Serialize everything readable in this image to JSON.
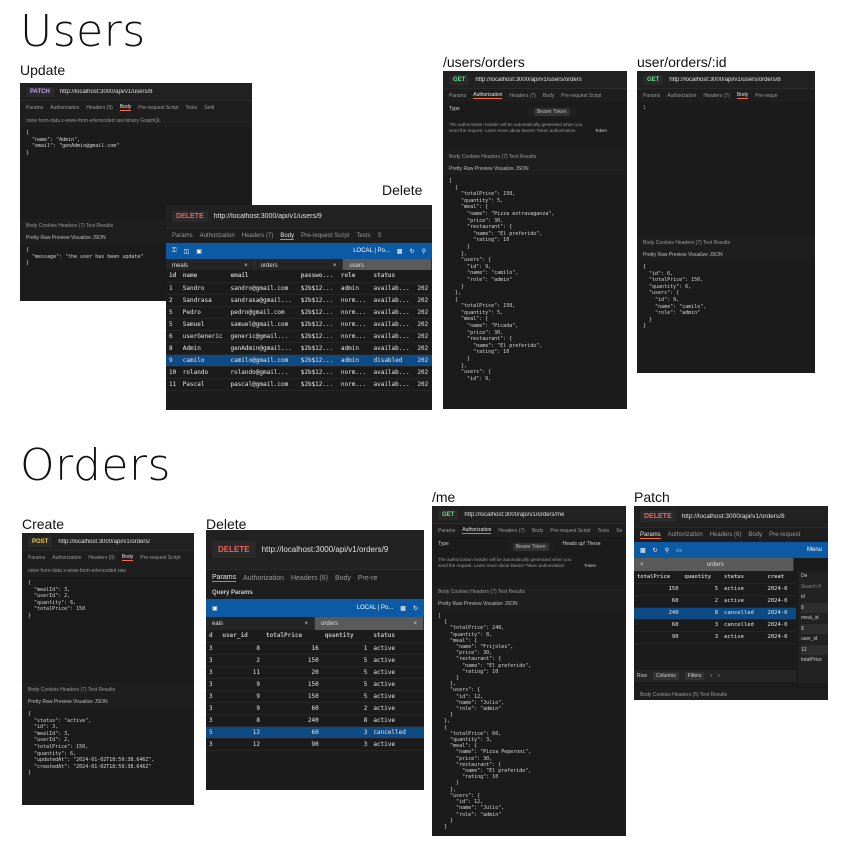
{
  "headings": {
    "users": "Users",
    "orders": "Orders"
  },
  "labels": {
    "update": "Update",
    "delete_user": "Delete",
    "users_orders": "/users/orders",
    "user_orders_id": "user/orders/:id",
    "create": "Create",
    "delete_order": "Delete",
    "me": "/me",
    "patch": "Patch"
  },
  "colors": {
    "get": "#6bdd9a",
    "post": "#f3ca4d",
    "patch": "#c6a0f6",
    "delete": "#f25f5c",
    "selection": "#0e4b84",
    "toolbar": "#0b5aa3"
  },
  "update": {
    "method": "PATCH",
    "url": "http://localhost:3000/api/v1/users/8",
    "tabs": [
      "Params",
      "Authorization",
      "Headers (9)",
      "Body",
      "Pre-request Script",
      "Tests",
      "Setti"
    ],
    "body_options": "none  form-data  x-www-form-urlencoded  raw  binary  GraphQL",
    "body_code": "{\n  \"name\": \"Admin\",\n  \"email\": \"genAdmin@gmail.com\"\n}",
    "resp_tabs": "Body  Cookies  Headers (7)  Test Results",
    "resp_views": "Pretty  Raw  Preview  Visualize  JSON",
    "resp_code": "{\n  \"message\": \"the user has been update\"\n}"
  },
  "delete_user": {
    "method": "DELETE",
    "url": "http://localhost:3000/api/v1/users/9",
    "tabs": [
      "Params",
      "Authorization",
      "Headers (7)",
      "Body",
      "Pre-request Script",
      "Tests",
      "S"
    ],
    "toolbar_db": "LOCAL | Po...",
    "tabstrip": [
      "meals",
      "orders",
      "users"
    ],
    "columns": [
      "id",
      "name",
      "email",
      "passwo...",
      "role",
      "status"
    ],
    "rows": [
      [
        "1",
        "Sandro",
        "sandro@gmail.com",
        "$2b$12...",
        "admin",
        "availab...",
        "202"
      ],
      [
        "2",
        "Sandrasa",
        "sandrasa@gmail...",
        "$2b$12...",
        "norm...",
        "availab...",
        "202"
      ],
      [
        "5",
        "Pedro",
        "pedro@gmail.com",
        "$2b$12...",
        "norm...",
        "availab...",
        "202"
      ],
      [
        "5",
        "Samuel",
        "samuel@gmail.com",
        "$2b$12...",
        "norm...",
        "availab...",
        "202"
      ],
      [
        "6",
        "userGeneric",
        "generic@gmail...",
        "$2b$12...",
        "norm...",
        "availab...",
        "202"
      ],
      [
        "8",
        "Admin",
        "genAdmin@gmail...",
        "$2b$12...",
        "admin",
        "availab...",
        "202"
      ],
      [
        "9",
        "camilo",
        "camilo@gmail.com",
        "$2b$12...",
        "admin",
        "disabled",
        "202"
      ],
      [
        "10",
        "rolando",
        "rolando@gmail...",
        "$2b$12...",
        "norm...",
        "availab...",
        "202"
      ],
      [
        "11",
        "Pascal",
        "pascal@gmail.com",
        "$2b$12...",
        "norm...",
        "availab...",
        "202"
      ]
    ]
  },
  "users_orders": {
    "method": "GET",
    "url": "http://localhost:3000/api/v1/users/orders",
    "tabs": [
      "Params",
      "Authorization",
      "Headers (7)",
      "Body",
      "Pre-request Script"
    ],
    "auth_type": "Type",
    "token_type": "Bearer Token",
    "auth_note": "The authorization header will be automatically generated when you send the request. Learn more about Bearer Token authorization",
    "token_label": "Token",
    "resp_tabs": "Body  Cookies  Headers (7)  Test Results",
    "resp_views": "Pretty  Raw  Preview  Visualize  JSON",
    "resp_code": "[\n  {\n    \"totalPrice\": 150,\n    \"quantity\": 5,\n    \"meal\": {\n      \"name\": \"Pizza extravaganza\",\n      \"price\": 30,\n      \"restaurant\": {\n        \"name\": \"El preferido\",\n        \"rating\": 10\n      }\n    },\n    \"users\": {\n      \"id\": 9,\n      \"name\": \"camilo\",\n      \"role\": \"admin\"\n    }\n  },\n  {\n    \"totalPrice\": 150,\n    \"quantity\": 5,\n    \"meal\": {\n      \"name\": \"Picada\",\n      \"price\": 30,\n      \"restaurant\": {\n        \"name\": \"El preferido\",\n        \"rating\": 10\n      }\n    },\n    \"users\": {\n      \"id\": 9,"
  },
  "user_orders_id": {
    "method": "GET",
    "url": "http://localhost:3000/api/v1/users/orders/8",
    "tabs": [
      "Params",
      "Authorization",
      "Headers (7)",
      "Body",
      "Pre-reque"
    ],
    "resp_tabs": "Body  Cookies  Headers (7)  Test Results",
    "resp_views": "Pretty  Raw  Preview  Visualize  JSON",
    "resp_code": "{\n  \"id\": 6,\n  \"totalPrice\": 150,\n  \"quantity\": 6,\n  \"users\": {\n    \"id\": 9,\n    \"name\": \"camilo\",\n    \"role\": \"admin\"\n  }\n}"
  },
  "create": {
    "method": "POST",
    "url": "http://localhost:3000/api/v1/orders/",
    "tabs": [
      "Params",
      "Authorization",
      "Headers (9)",
      "Body",
      "Pre-request Script"
    ],
    "body_options": "none  form-data  x-www-form-urlencoded  raw",
    "body_code": "{\n  \"mealId\": 3,\n  \"userId\": 2,\n  \"quantity\": 6,\n  \"totalPrice\": 150\n}",
    "resp_tabs": "Body  Cookies  Headers (7)  Test Results",
    "resp_views": "Pretty  Raw  Preview  Visualize  JSON",
    "resp_code": "{\n  \"status\": \"active\",\n  \"id\": 3,\n  \"mealId\": 3,\n  \"userId\": 2,\n  \"totalPrice\": 150,\n  \"quantity\": 6,\n  \"updatedAt\": \"2024-01-02T18:59:38.646Z\",\n  \"createdAt\": \"2024-01-02T18:59:38.646Z\"\n}"
  },
  "delete_order": {
    "method": "DELETE",
    "url": "http://localhost:3000/api/v1/orders/9",
    "tabs": [
      "Params",
      "Authorization",
      "Headers (6)",
      "Body",
      "Pre-re"
    ],
    "query_params": "Query Params",
    "toolbar_db": "LOCAL | Po...",
    "tabstrip": [
      "eals",
      "orders"
    ],
    "columns": [
      "d",
      "user_id",
      "totalPrice",
      "quantity",
      "status"
    ],
    "rows": [
      [
        "3",
        "8",
        "16",
        "1",
        "active"
      ],
      [
        "3",
        "2",
        "150",
        "5",
        "active"
      ],
      [
        "3",
        "11",
        "20",
        "5",
        "active"
      ],
      [
        "3",
        "9",
        "150",
        "5",
        "active"
      ],
      [
        "3",
        "9",
        "150",
        "5",
        "active"
      ],
      [
        "3",
        "9",
        "60",
        "2",
        "active"
      ],
      [
        "3",
        "8",
        "240",
        "8",
        "active"
      ],
      [
        "5",
        "12",
        "60",
        "3",
        "cancelled"
      ],
      [
        "3",
        "12",
        "90",
        "3",
        "active"
      ]
    ]
  },
  "me": {
    "method": "GET",
    "url": "http://localhost:3000/api/v1/orders/me",
    "tabs": [
      "Params",
      "Authorization",
      "Headers (7)",
      "Body",
      "Pre-request Script",
      "Tests",
      "Se"
    ],
    "auth_type": "Type",
    "token_type": "Bearer Token",
    "heads_up": "Heads up! These",
    "auth_note": "The authorization header will be automatically generated when you send the request. Learn more about Bearer Token authorization",
    "token_label": "Token",
    "resp_tabs": "Body  Cookies  Headers (7)  Test Results",
    "resp_views": "Pretty  Raw  Preview  Visualize  JSON",
    "resp_code": "[\n  {\n    \"totalPrice\": 240,\n    \"quantity\": 8,\n    \"meal\": {\n      \"name\": \"Frijoles\",\n      \"price\": 30,\n      \"restaurant\": {\n        \"name\": \"El preferido\",\n        \"rating\": 10\n      }\n    },\n    \"users\": {\n      \"id\": 12,\n      \"name\": \"Julio\",\n      \"role\": \"admin\"\n    }\n  },\n  {\n    \"totalPrice\": 60,\n    \"quantity\": 3,\n    \"meal\": {\n      \"name\": \"Pizza Peperoni\",\n      \"price\": 30,\n      \"restaurant\": {\n        \"name\": \"El preferido\",\n        \"rating\": 10\n      }\n    },\n    \"users\": {\n      \"id\": 12,\n      \"name\": \"Julio\",\n      \"role\": \"admin\"\n    }\n  }"
  },
  "patch": {
    "method": "DELETE",
    "url": "http://localhost:3000/api/v1/orders/8",
    "tabs": [
      "Params",
      "Authorization",
      "Headers (6)",
      "Body",
      "Pre-request"
    ],
    "menu": "Menu",
    "tab": "orders",
    "columns": [
      "totalPrice",
      "quantity",
      "status",
      "creat"
    ],
    "rows": [
      [
        "150",
        "5",
        "active",
        "2024-0"
      ],
      [
        "60",
        "2",
        "active",
        "2024-0"
      ],
      [
        "240",
        "8",
        "cancelled",
        "2024-0"
      ],
      [
        "60",
        "3",
        "cancelled",
        "2024-0"
      ],
      [
        "90",
        "3",
        "active",
        "2024-0"
      ]
    ],
    "side": [
      "De",
      "Search fi",
      "id",
      "8",
      "meal_id",
      "8",
      "user_id",
      "12",
      "totalPrice"
    ],
    "bottom": [
      "Row",
      "Columns",
      "Filters"
    ],
    "resp_tabs": "Body  Cookies  Headers (5)  Test Results"
  }
}
